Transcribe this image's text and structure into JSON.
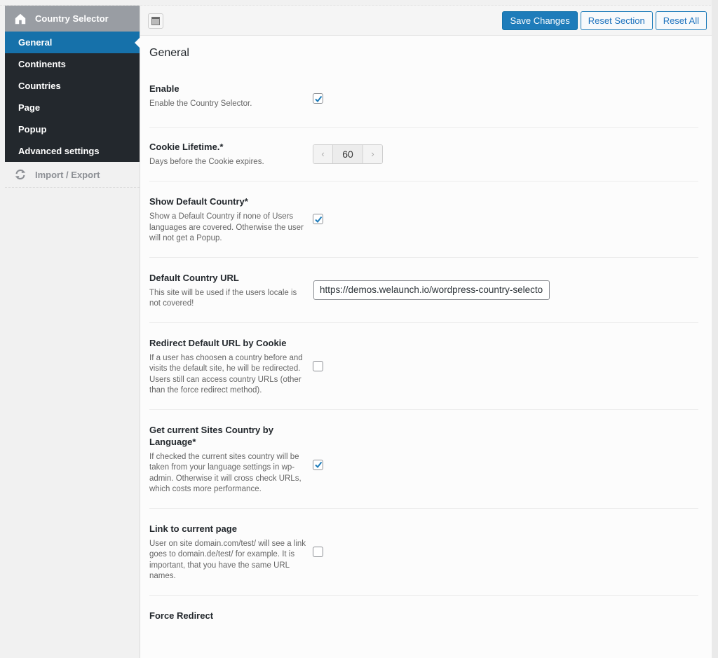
{
  "sidebar": {
    "title": "Country Selector",
    "title_icon": "home-icon",
    "items": [
      {
        "label": "General",
        "active": true
      },
      {
        "label": "Continents",
        "active": false
      },
      {
        "label": "Countries",
        "active": false
      },
      {
        "label": "Page",
        "active": false
      },
      {
        "label": "Popup",
        "active": false
      },
      {
        "label": "Advanced settings",
        "active": false
      }
    ],
    "import_export": {
      "label": "Import / Export",
      "icon": "refresh-icon"
    }
  },
  "toolbar": {
    "expand_icon": "expand-panel-icon",
    "save_label": "Save Changes",
    "reset_section_label": "Reset Section",
    "reset_all_label": "Reset All"
  },
  "colors": {
    "primary": "#1e7cba",
    "sidebar_dark": "#23282d",
    "sidebar_header": "#999da3"
  },
  "section": {
    "title": "General",
    "settings": [
      {
        "title": "Enable",
        "description": "Enable the Country Selector.",
        "type": "checkbox",
        "checked": true
      },
      {
        "title": "Cookie Lifetime.*",
        "description": "Days before the Cookie expires.",
        "type": "stepper",
        "value": "60",
        "prev_glyph": "‹",
        "next_glyph": "›"
      },
      {
        "title": "Show Default Country*",
        "description": "Show a Default Country if none of Users languages are covered. Otherwise the user will not get a Popup.",
        "type": "checkbox",
        "checked": true
      },
      {
        "title": "Default Country URL",
        "description": "This site will be used if the users locale is not covered!",
        "type": "text",
        "value": "https://demos.welaunch.io/wordpress-country-selector/"
      },
      {
        "title": "Redirect Default URL by Cookie",
        "description": "If a user has choosen a country before and visits the default site, he will be redirected. Users still can access country URLs (other than the force redirect method).",
        "type": "checkbox",
        "checked": false
      },
      {
        "title": "Get current Sites Country by Language*",
        "description": "If checked the current sites country will be taken from your language settings in wp-admin. Otherwise it will cross check URLs, which costs more performance.",
        "type": "checkbox",
        "checked": true
      },
      {
        "title": "Link to current page",
        "description": "User on site domain.com/test/ will see a link goes to domain.de/test/ for example. It is important, that you have the same URL names.",
        "type": "checkbox",
        "checked": false
      },
      {
        "title": "Force Redirect",
        "description": "",
        "type": "none"
      }
    ]
  }
}
